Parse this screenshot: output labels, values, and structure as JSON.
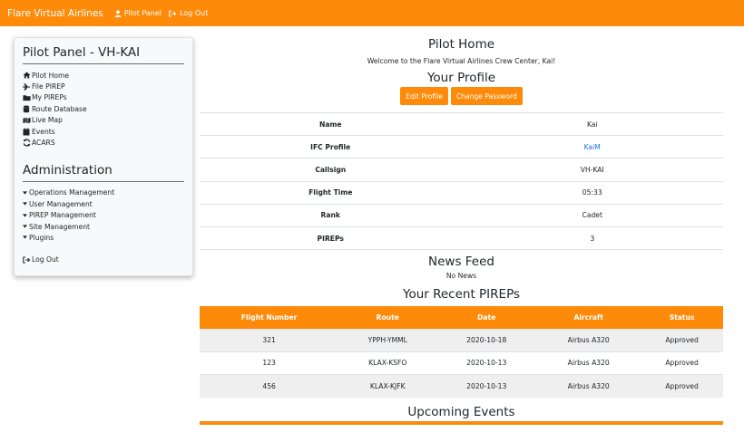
{
  "header": {
    "brand": "Flare Virtual Airlines",
    "links": [
      {
        "label": "Pilot Panel",
        "icon": "user-icon"
      },
      {
        "label": "Log Out",
        "icon": "sign-out-icon"
      }
    ]
  },
  "sidebar": {
    "title": "Pilot Panel - VH-KAI",
    "items": [
      {
        "label": "Pilot Home",
        "icon": "home-icon"
      },
      {
        "label": "File PIREP",
        "icon": "plane-icon"
      },
      {
        "label": "My PIREPs",
        "icon": "folder-icon"
      },
      {
        "label": "Route Database",
        "icon": "database-icon"
      },
      {
        "label": "Live Map",
        "icon": "map-icon"
      },
      {
        "label": "Events",
        "icon": "calendar-icon"
      },
      {
        "label": "ACARS",
        "icon": "sync-icon"
      }
    ],
    "admin_title": "Administration",
    "admin_items": [
      {
        "label": "Operations Management",
        "icon": "caret-down-icon"
      },
      {
        "label": "User Management",
        "icon": "caret-down-icon"
      },
      {
        "label": "PIREP Management",
        "icon": "caret-down-icon"
      },
      {
        "label": "Site Management",
        "icon": "caret-down-icon"
      },
      {
        "label": "Plugins",
        "icon": "caret-down-icon"
      }
    ],
    "logout_label": "Log Out"
  },
  "main": {
    "title": "Pilot Home",
    "welcome": "Welcome to the Flare Virtual Airlines Crew Center, Kai!",
    "profile_title": "Your Profile",
    "edit_profile_label": "Edit Profile",
    "change_password_label": "Change Password",
    "profile_rows": [
      {
        "label": "Name",
        "value": "Kai"
      },
      {
        "label": "IFC Profile",
        "value": "KaiM"
      },
      {
        "label": "Callsign",
        "value": "VH-KAI"
      },
      {
        "label": "Flight Time",
        "value": "05:33"
      },
      {
        "label": "Rank",
        "value": "Cadet"
      },
      {
        "label": "PIREPs",
        "value": "3"
      }
    ],
    "news_title": "News Feed",
    "news_empty": "No News",
    "pireps_title": "Your Recent PIREPs",
    "pireps_headers": [
      "Flight Number",
      "Route",
      "Date",
      "Aircraft",
      "Status"
    ],
    "pireps_rows": [
      [
        "321",
        "YPPH-YMML",
        "2020-10-18",
        "Airbus A320",
        "Approved"
      ],
      [
        "123",
        "KLAX-KSFO",
        "2020-10-13",
        "Airbus A320",
        "Approved"
      ],
      [
        "456",
        "KLAX-KJFK",
        "2020-10-13",
        "Airbus A320",
        "Approved"
      ]
    ],
    "events_title": "Upcoming Events"
  },
  "colors": {
    "accent": "#fe8a0a",
    "link": "#1a73e8",
    "striped_row": "#efefef"
  }
}
